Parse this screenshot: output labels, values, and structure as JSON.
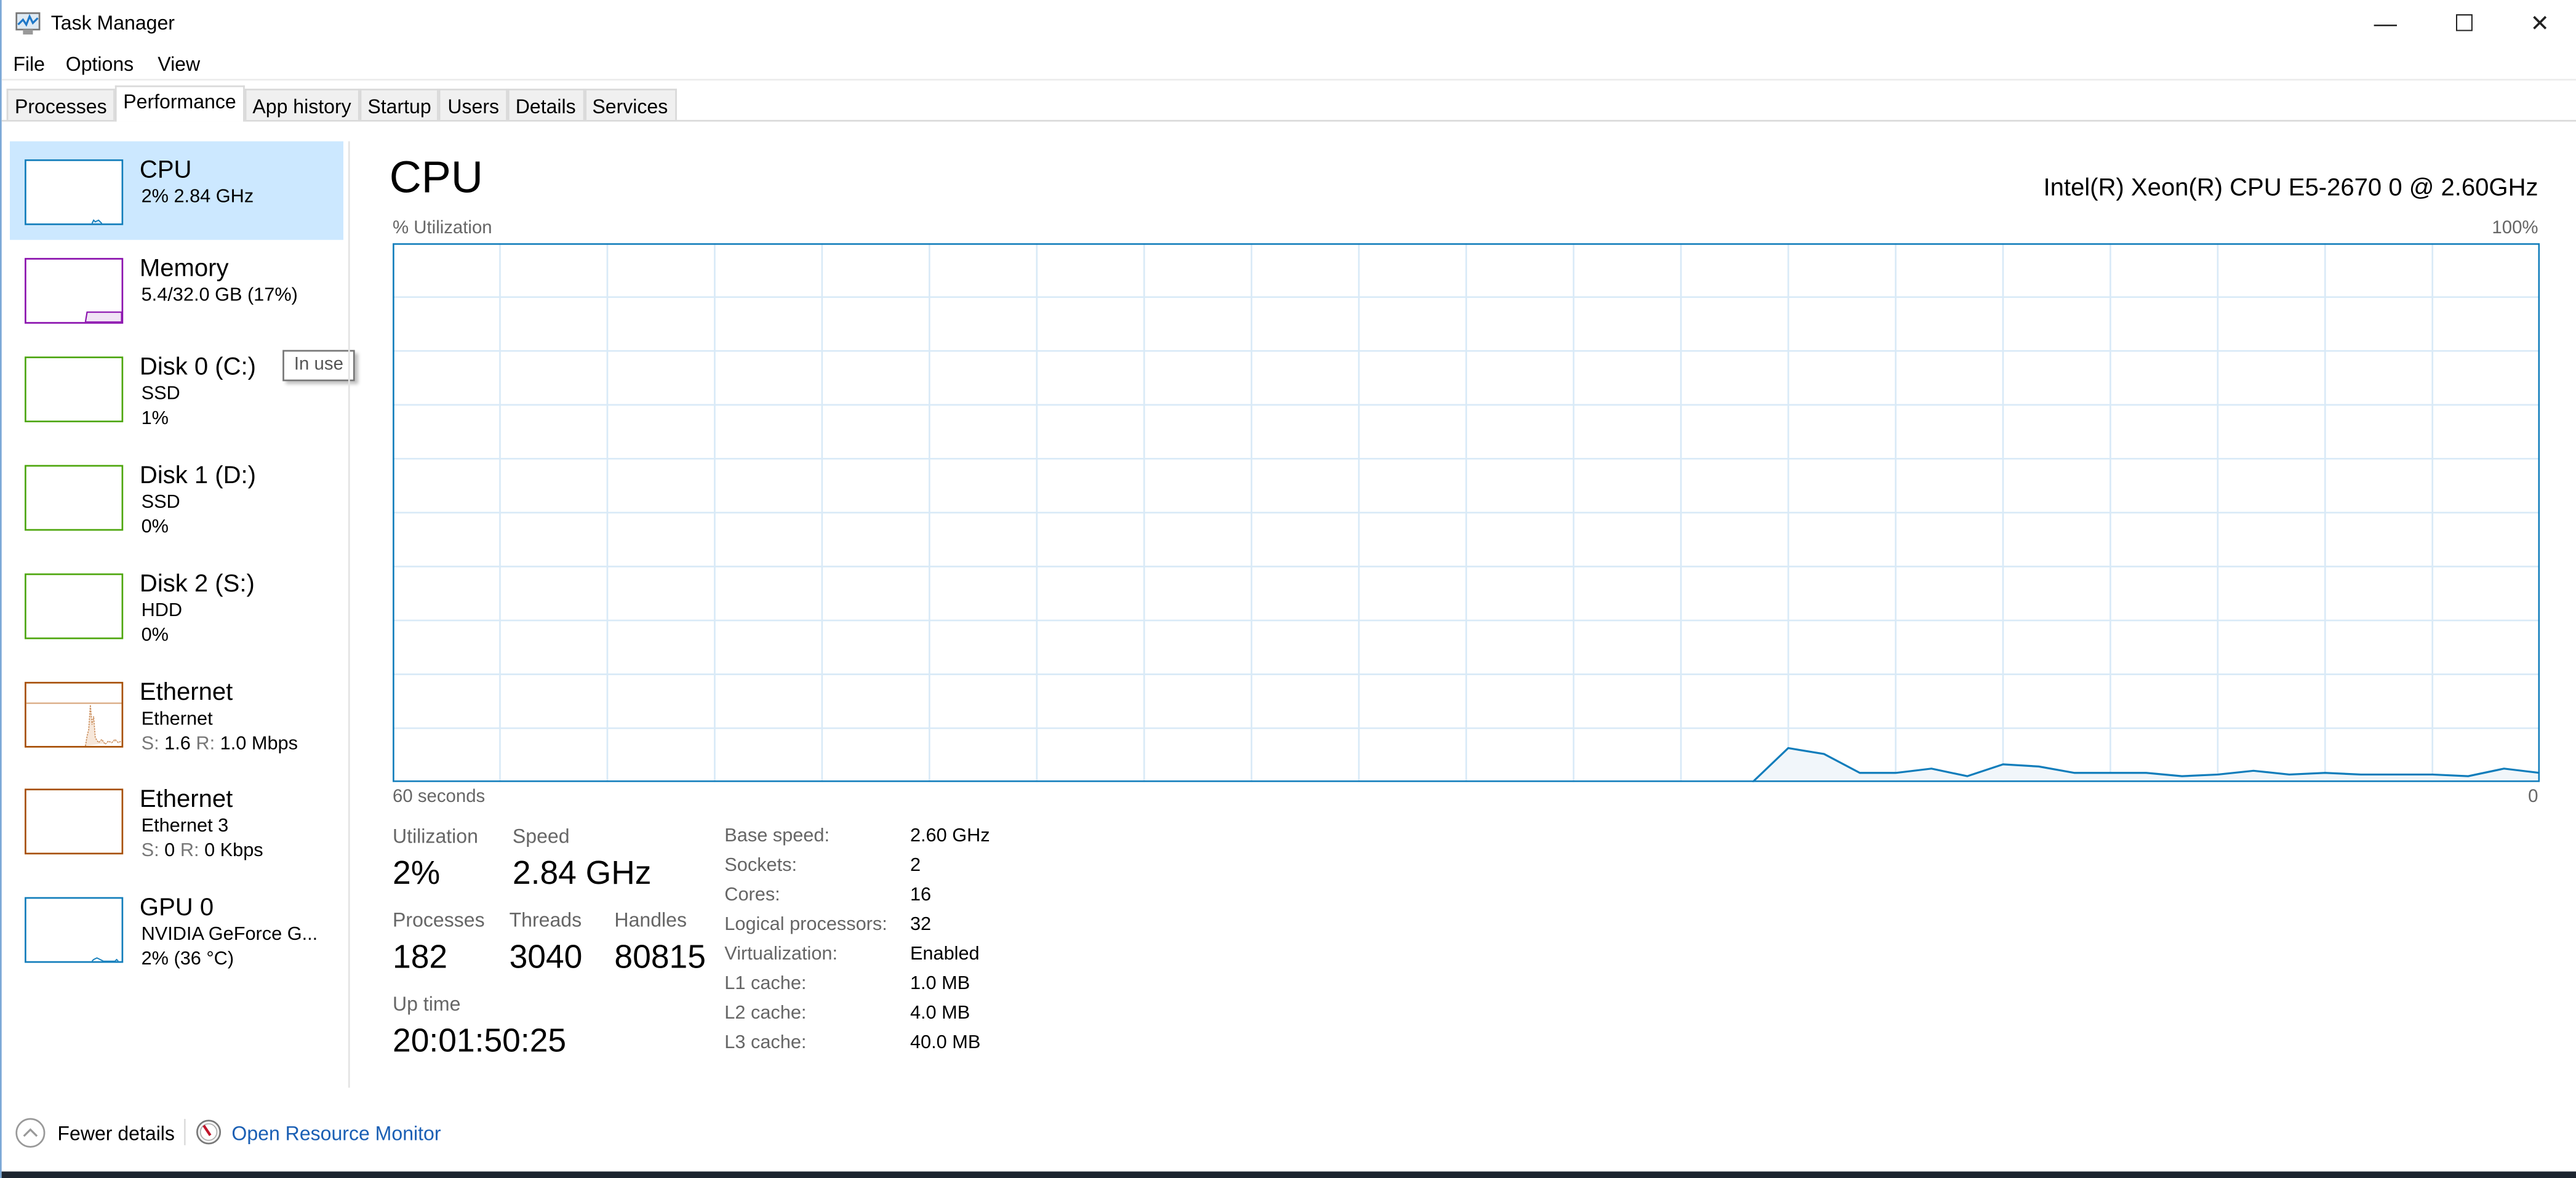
{
  "window": {
    "title": "Task Manager",
    "controls": {
      "minimize": "—",
      "maximize": "☐",
      "close": "✕"
    }
  },
  "menu": [
    "File",
    "Options",
    "View"
  ],
  "tabs": [
    "Processes",
    "Performance",
    "App history",
    "Startup",
    "Users",
    "Details",
    "Services"
  ],
  "active_tab": "Performance",
  "sidebar": {
    "items": [
      {
        "name": "CPU",
        "line1": "2% 2.84 GHz",
        "color": "#117dbb"
      },
      {
        "name": "Memory",
        "line1": "5.4/32.0 GB (17%)",
        "color": "#8b12ae",
        "fill_percent": 17
      },
      {
        "name": "Disk 0 (C:)",
        "line1": "SSD",
        "line2": "1%",
        "color": "#4da60c"
      },
      {
        "name": "Disk 1 (D:)",
        "line1": "SSD",
        "line2": "0%",
        "color": "#4da60c"
      },
      {
        "name": "Disk 2 (S:)",
        "line1": "HDD",
        "line2": "0%",
        "color": "#4da60c"
      },
      {
        "name": "Ethernet",
        "line1": "Ethernet",
        "s_label": "S:",
        "s_value": "1.6",
        "r_label": "R:",
        "r_value": "1.0 Mbps",
        "color": "#a74f01"
      },
      {
        "name": "Ethernet",
        "line1": "Ethernet 3",
        "s_label": "S:",
        "s_value": "0",
        "r_label": "R:",
        "r_value": "0 Kbps",
        "color": "#a74f01"
      },
      {
        "name": "GPU 0",
        "line1": "NVIDIA GeForce G...",
        "line2": "2% (36 °C)",
        "color": "#117dbb"
      }
    ],
    "tooltip": "In use"
  },
  "main": {
    "title": "CPU",
    "cpu_model": "Intel(R) Xeon(R) CPU E5-2670 0 @ 2.60GHz",
    "stats": {
      "utilization_label": "Utilization",
      "utilization": "2%",
      "speed_label": "Speed",
      "speed": "2.84 GHz",
      "processes_label": "Processes",
      "processes": "182",
      "threads_label": "Threads",
      "threads": "3040",
      "handles_label": "Handles",
      "handles": "80815",
      "uptime_label": "Up time",
      "uptime": "20:01:50:25"
    },
    "specs": [
      {
        "label": "Base speed:",
        "value": "2.60 GHz"
      },
      {
        "label": "Sockets:",
        "value": "2"
      },
      {
        "label": "Cores:",
        "value": "16"
      },
      {
        "label": "Logical processors:",
        "value": "32"
      },
      {
        "label": "Virtualization:",
        "value": "Enabled"
      },
      {
        "label": "L1 cache:",
        "value": "1.0 MB"
      },
      {
        "label": "L2 cache:",
        "value": "4.0 MB"
      },
      {
        "label": "L3 cache:",
        "value": "40.0 MB"
      }
    ]
  },
  "chart_data": {
    "type": "area",
    "ylabel": "% Utilization",
    "ymax_label": "100%",
    "xleft_label": "60 seconds",
    "xright_label": "0",
    "xlim": [
      60,
      0
    ],
    "ylim": [
      0,
      100
    ],
    "grid": true,
    "color": "#117dbb",
    "x_seconds_ago": [
      22,
      21,
      20,
      19,
      18,
      17,
      16,
      15,
      14,
      13,
      12,
      11,
      10,
      9,
      8,
      7,
      6,
      5,
      4,
      3,
      2,
      1,
      0
    ],
    "values": [
      0,
      6.3,
      5.2,
      1.7,
      1.7,
      2.5,
      1.1,
      3.3,
      2.9,
      1.7,
      1.7,
      1.7,
      1.1,
      1.4,
      2.1,
      1.4,
      1.7,
      1.4,
      1.4,
      1.4,
      1.1,
      2.5,
      1.7
    ]
  },
  "footer": {
    "fewer_details": "Fewer details",
    "resource_monitor": "Open Resource Monitor"
  }
}
